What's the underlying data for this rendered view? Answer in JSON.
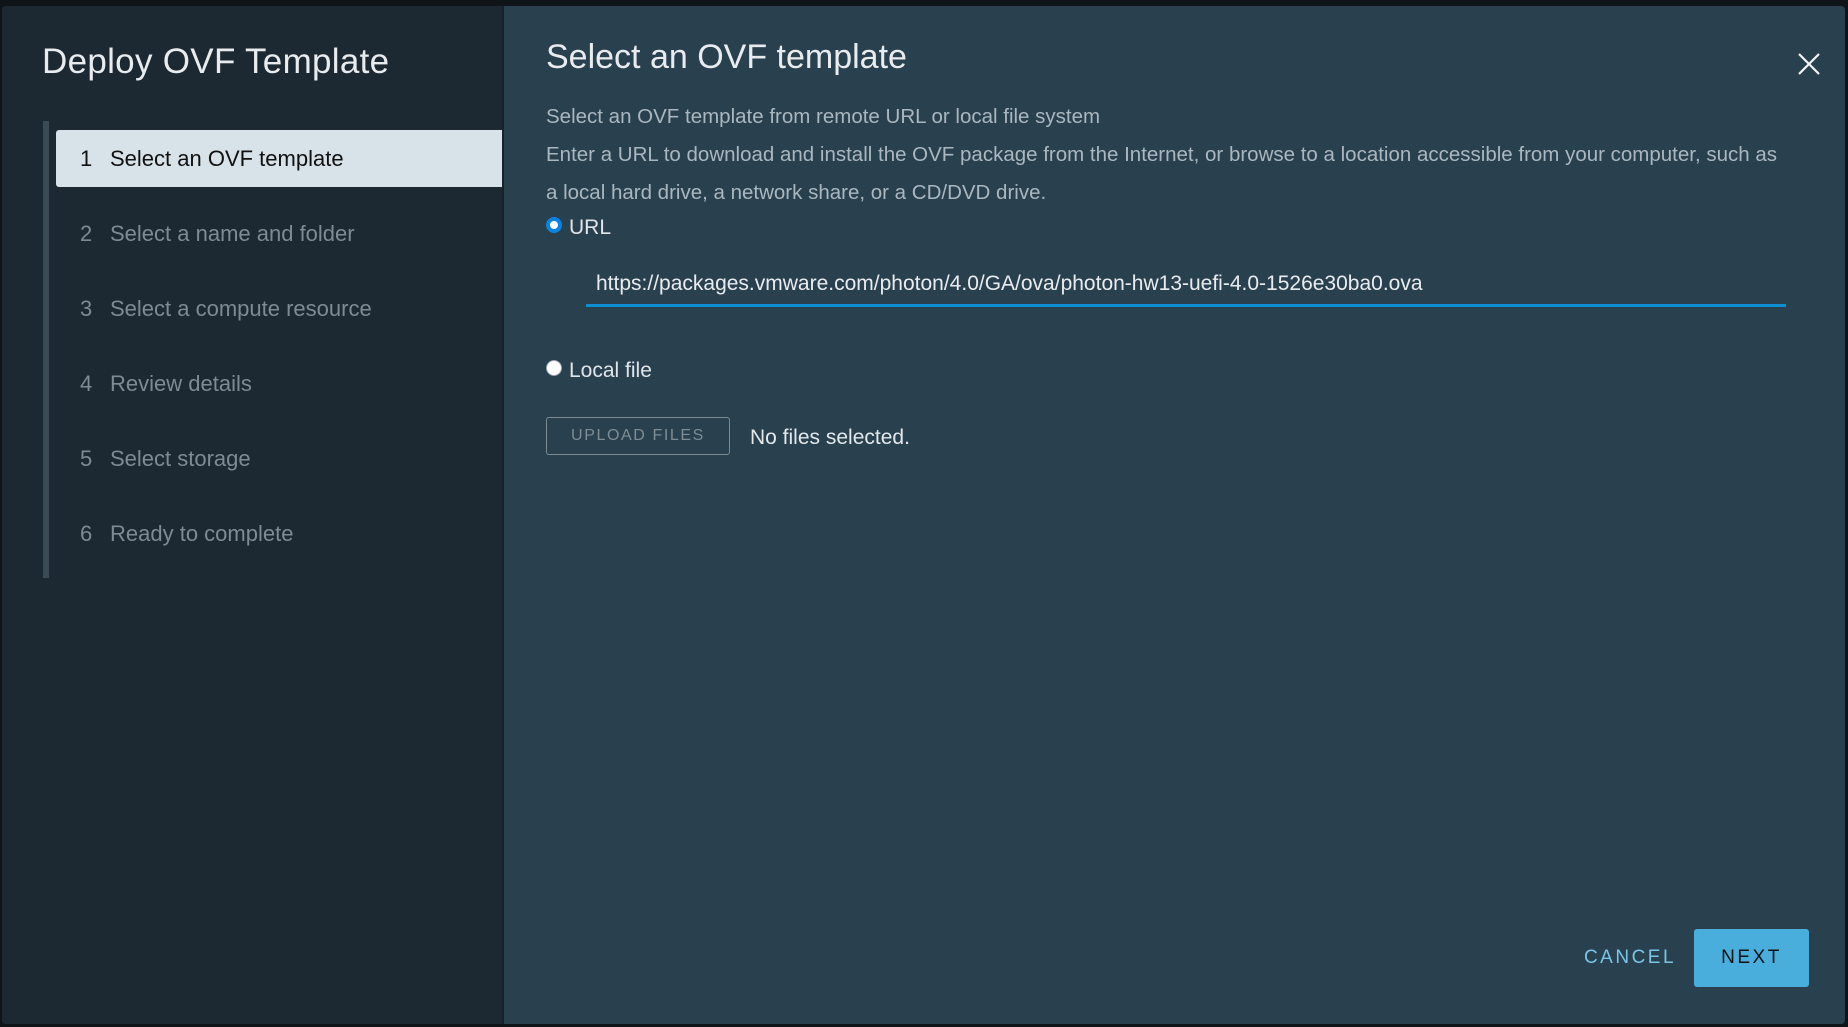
{
  "wizard": {
    "title": "Deploy OVF Template",
    "steps": [
      {
        "num": "1",
        "label": "Select an OVF template",
        "active": true
      },
      {
        "num": "2",
        "label": "Select a name and folder",
        "active": false
      },
      {
        "num": "3",
        "label": "Select a compute resource",
        "active": false
      },
      {
        "num": "4",
        "label": "Review details",
        "active": false
      },
      {
        "num": "5",
        "label": "Select storage",
        "active": false
      },
      {
        "num": "6",
        "label": "Ready to complete",
        "active": false
      }
    ]
  },
  "page": {
    "title": "Select an OVF template",
    "close_icon": "close-x-icon",
    "description": [
      "Select an OVF template from remote URL or local file system",
      "Enter a URL to download and install the OVF package from the Internet, or browse to a location accessible from your computer, such as a local hard drive, a network share, or a CD/DVD drive."
    ],
    "source_options": {
      "url_label": "URL",
      "url_selected": true,
      "url_value": "https://packages.vmware.com/photon/4.0/GA/ova/photon-hw13-uefi-4.0-1526e30ba0.ova",
      "local_label": "Local file",
      "local_selected": false
    },
    "upload_button": "UPLOAD FILES",
    "upload_status": "No files selected."
  },
  "footer": {
    "cancel_label": "CANCEL",
    "next_label": "NEXT"
  },
  "colors": {
    "accent": "#49aedb",
    "input_underline": "#0f8fd1",
    "active_step_bg": "#d8e3e9"
  }
}
